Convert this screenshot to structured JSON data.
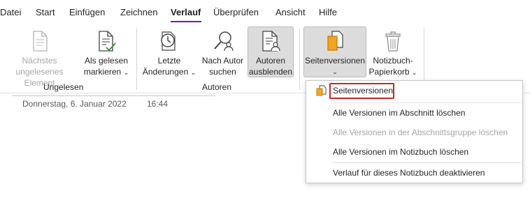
{
  "tabs": [
    {
      "label": "Datei"
    },
    {
      "label": "Start"
    },
    {
      "label": "Einfügen"
    },
    {
      "label": "Zeichnen"
    },
    {
      "label": "Verlauf",
      "active": true
    },
    {
      "label": "Überprüfen"
    },
    {
      "label": "Ansicht"
    },
    {
      "label": "Hilfe"
    }
  ],
  "ribbon": {
    "ungelesen": {
      "label": "Ungelesen",
      "next_unread": {
        "line1": "Nächstes",
        "line2": "ungelesenes Element",
        "icon": "next-unread-page-icon"
      },
      "mark_read": {
        "line1": "Als gelesen",
        "line2": "markieren",
        "icon": "mark-as-read-icon"
      }
    },
    "autoren": {
      "label": "Autoren",
      "recent_changes": {
        "line1": "Letzte",
        "line2": "Änderungen",
        "icon": "clock-icon"
      },
      "find_by_author": {
        "line1": "Nach Autor",
        "line2": "suchen",
        "icon": "search-person-icon"
      },
      "hide_authors": {
        "line1": "Autoren",
        "line2": "ausblenden",
        "icon": "hide-authors-icon"
      }
    },
    "versions": {
      "page_versions": {
        "line1": "Seitenversionen",
        "icon": "page-versions-icon"
      },
      "recycle_bin": {
        "line1": "Notizbuch-",
        "line2": "Papierkorb",
        "icon": "recycle-bin-icon"
      }
    }
  },
  "page": {
    "date": "Donnerstag, 6. Januar 2022",
    "time": "16:44"
  },
  "menu": {
    "items": [
      {
        "label": "Seitenversionen",
        "icon": "page-versions-icon"
      },
      {
        "label": "Alle Versionen im Abschnitt löschen"
      },
      {
        "label": "Alle Versionen in der Abschnittsgruppe löschen",
        "disabled": true
      },
      {
        "label": "Alle Versionen im Notizbuch löschen"
      },
      {
        "label": "Verlauf für dieses Notizbuch deaktivieren"
      }
    ]
  },
  "colors": {
    "accent": "#7719aa",
    "focus_border": "#c42b1c",
    "disabled_text": "#a6a6a6"
  }
}
